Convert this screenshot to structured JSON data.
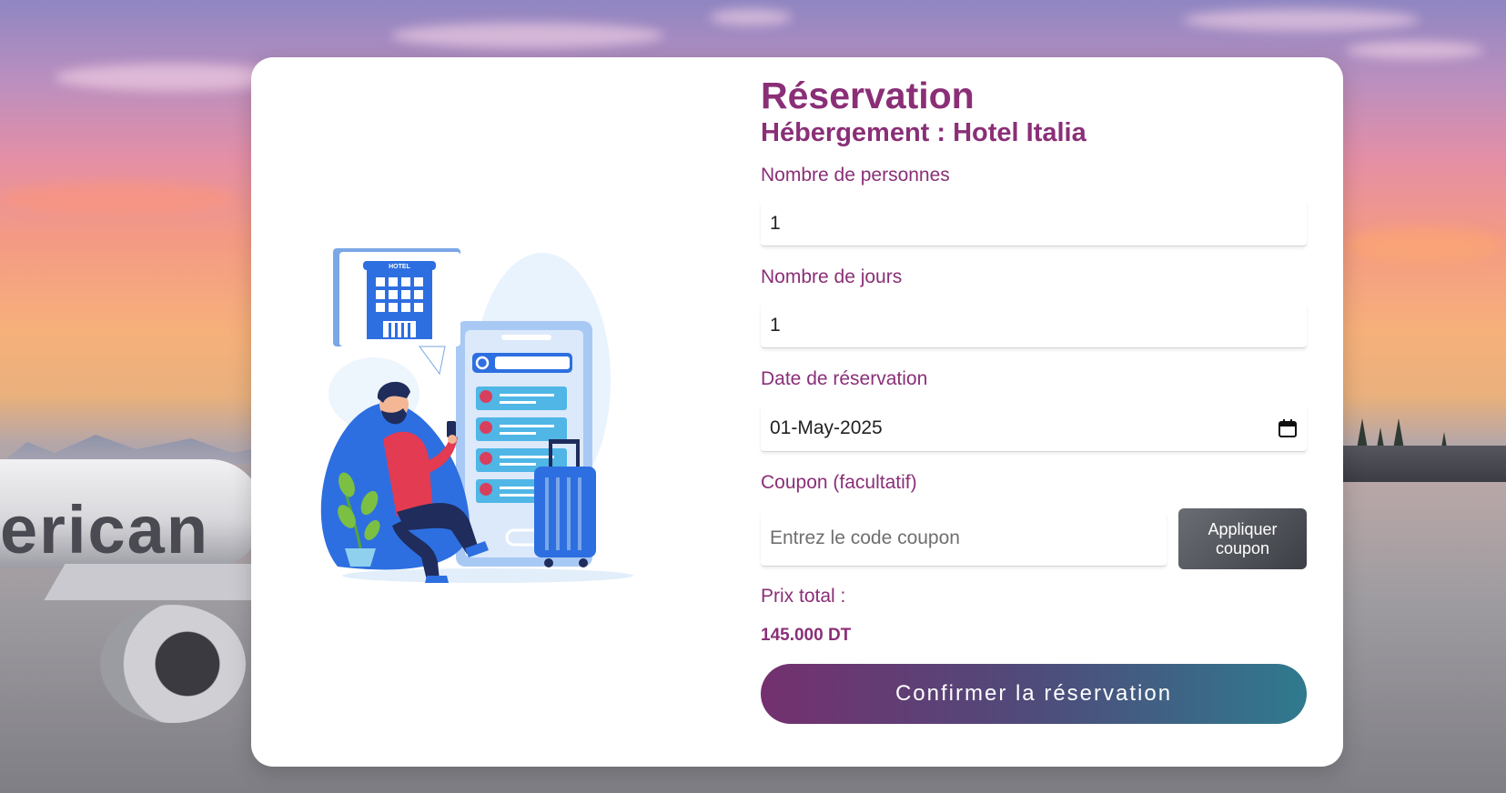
{
  "page": {
    "title": "Réservation",
    "subtitle": "Hébergement : Hotel Italia"
  },
  "form": {
    "persons": {
      "label": "Nombre de personnes",
      "value": "1"
    },
    "days": {
      "label": "Nombre de jours",
      "value": "1"
    },
    "date": {
      "label": "Date de réservation",
      "value": "01-May-2025"
    },
    "coupon": {
      "label": "Coupon (facultatif)",
      "placeholder": "Entrez le code coupon",
      "apply_label": "Appliquer coupon"
    },
    "total": {
      "label": "Prix total :",
      "value": "145.000 DT"
    },
    "confirm_label": "Confirmer la réservation"
  },
  "illustration": {
    "hotel_sign": "HOTEL"
  },
  "background": {
    "plane_text": "erican"
  },
  "colors": {
    "accent": "#8a2f77",
    "confirm_start": "#74306f",
    "confirm_end": "#2f7a8e",
    "coupon_button": "#4c4f55"
  }
}
